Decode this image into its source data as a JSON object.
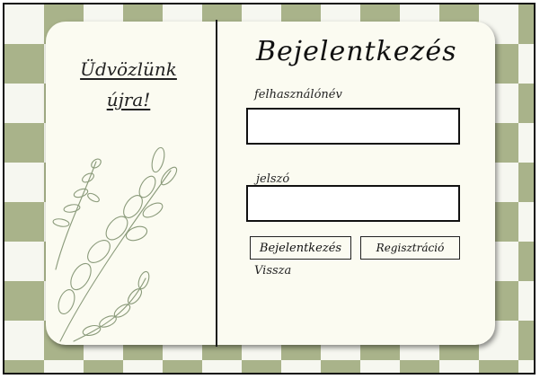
{
  "welcome": {
    "line1": "Üdvözlünk",
    "line2": "újra!"
  },
  "login": {
    "title": "Bejelentkezés",
    "username_label": "felhasználónév",
    "username_value": "",
    "password_label": "jelszó",
    "password_value": "",
    "login_button": "Bejelentkezés",
    "register_button": "Regisztráció",
    "back_link": "Vissza"
  },
  "colors": {
    "checker_dark": "#a9b38a",
    "checker_light": "#f6f7f0",
    "card": "#fbfbf1",
    "ink": "#111111"
  },
  "icons": {
    "decoration": "plant-sketch-icon"
  }
}
